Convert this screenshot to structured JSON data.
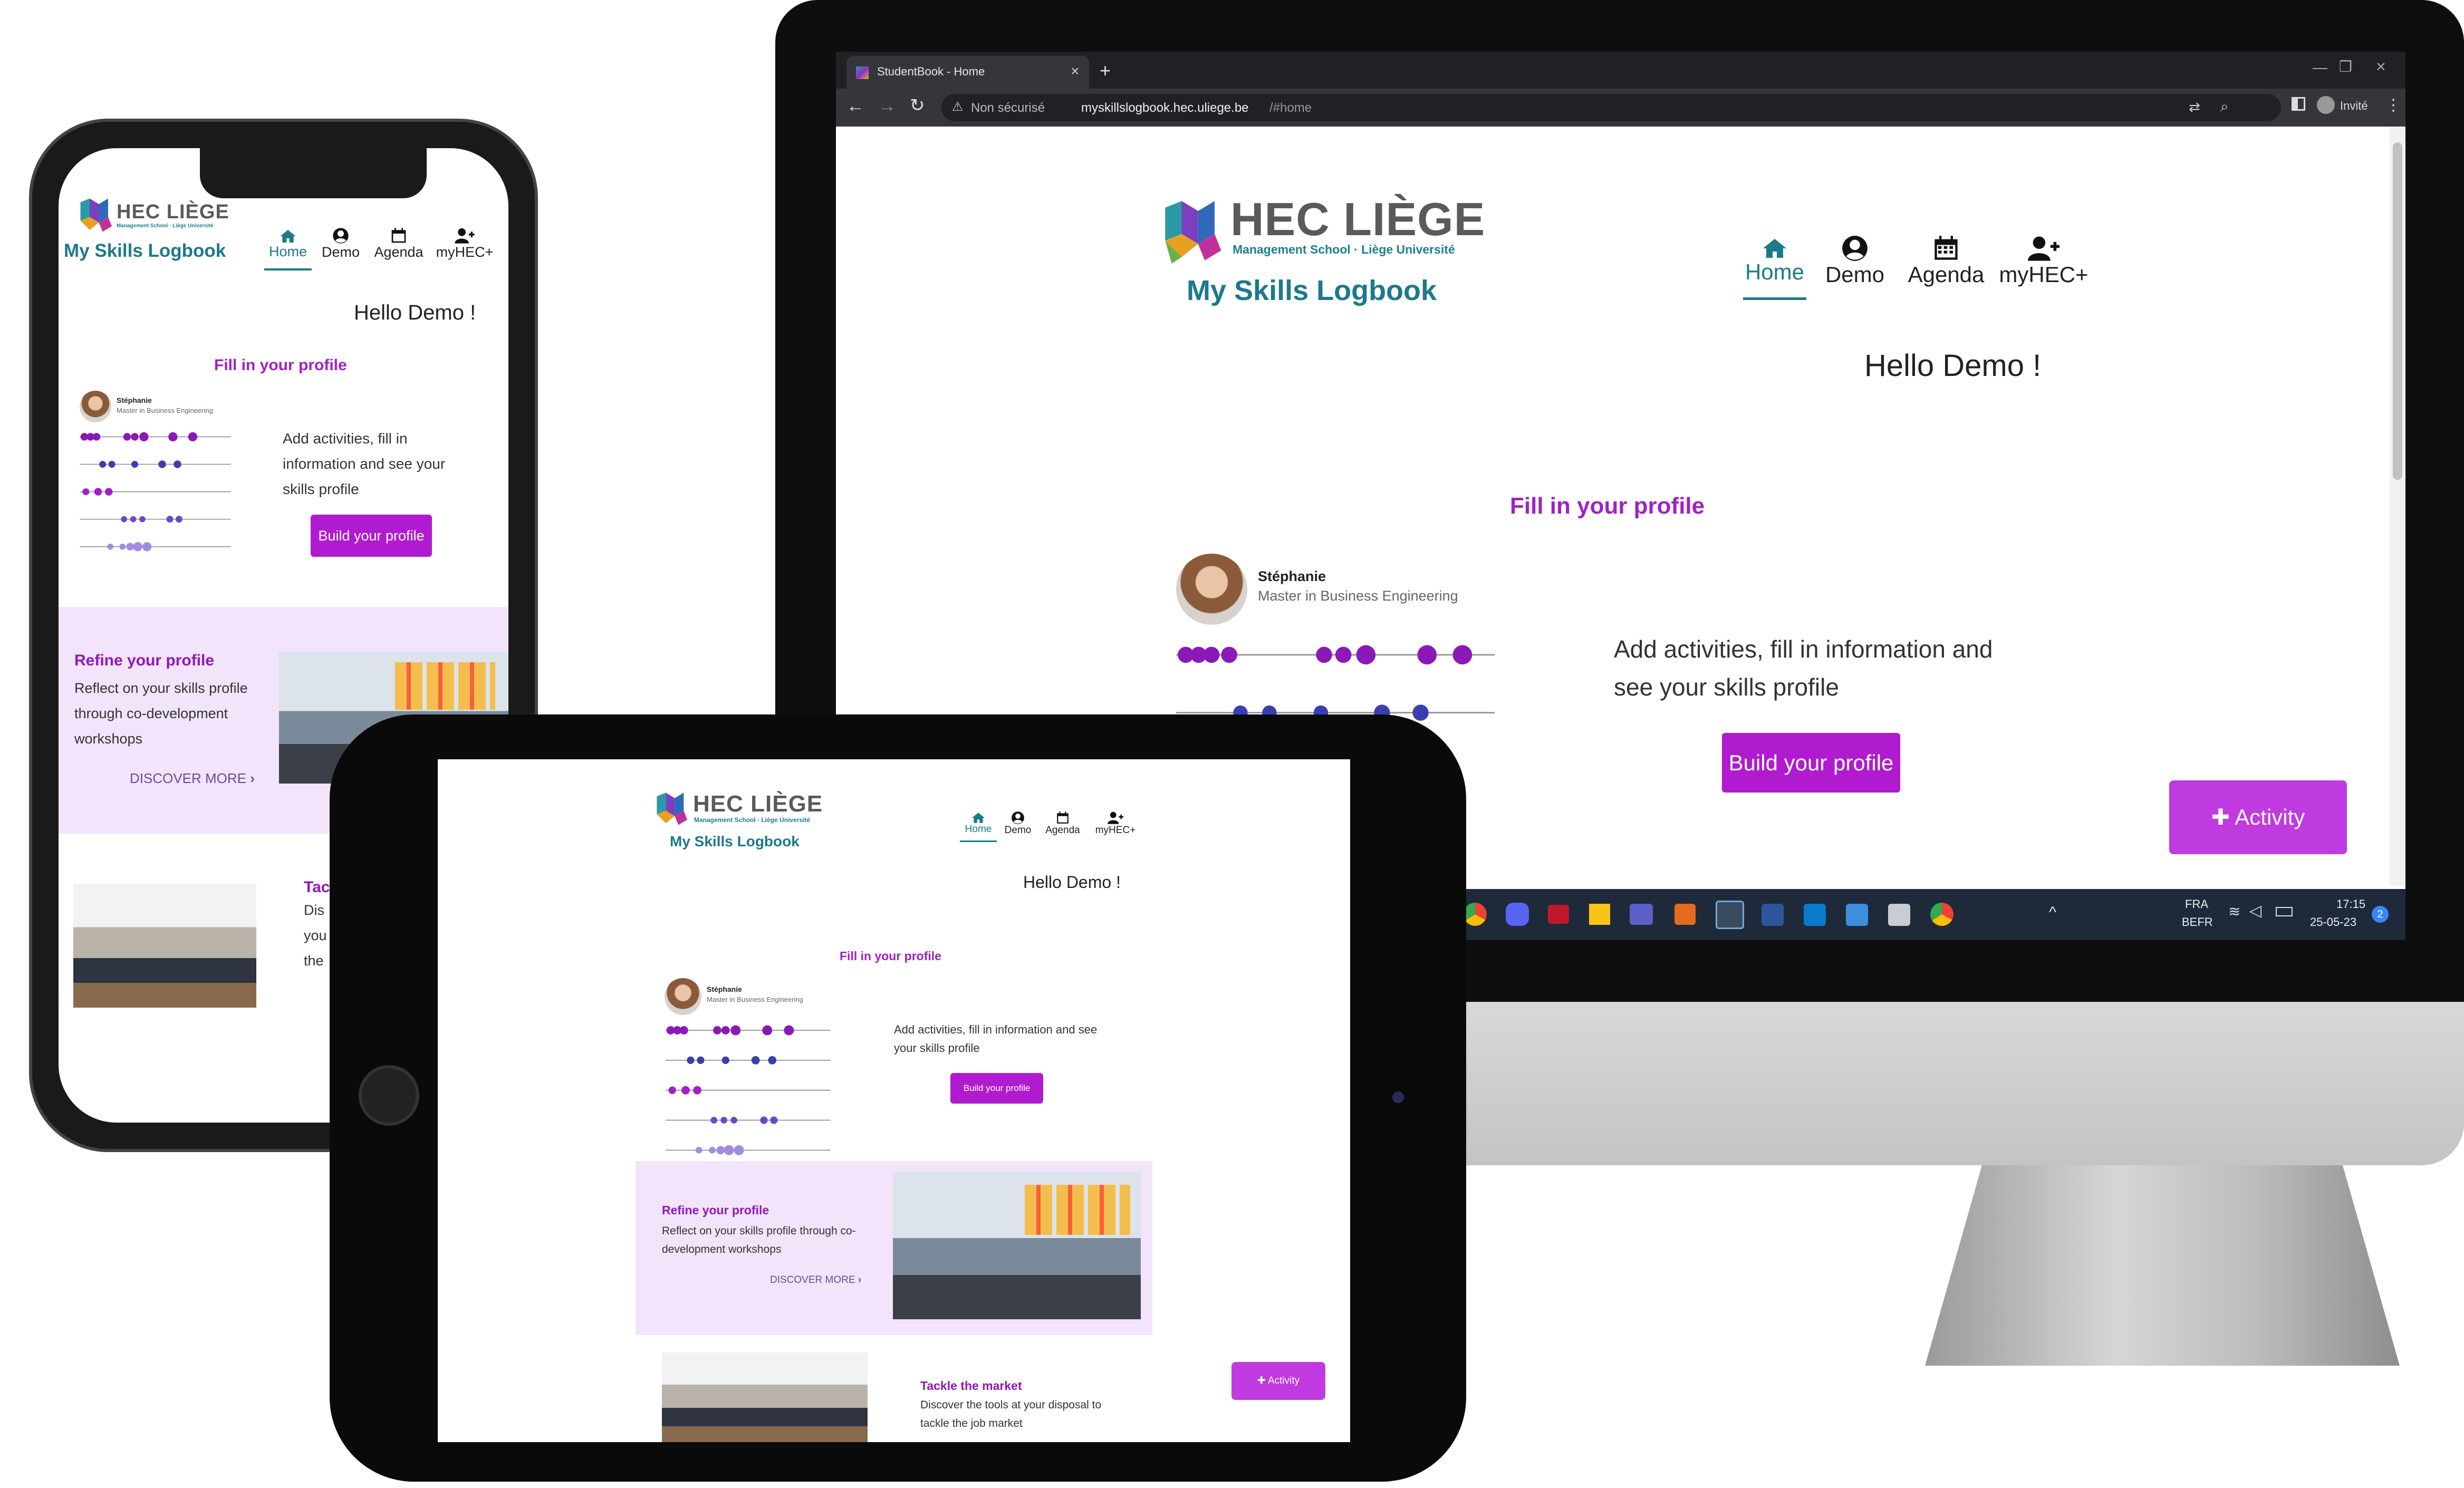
{
  "browser": {
    "tab_title": "StudentBook - Home",
    "not_secure": "Non sécurisé",
    "url_host": "myskillslogbook.hec.uliege.be",
    "url_path": "/#home",
    "profile_label": "Invité"
  },
  "app": {
    "logo_word": "HEC LIÈGE",
    "logo_sub": "Management School · Liège Université",
    "title": "My Skills Logbook",
    "nav": [
      {
        "label": "Home",
        "icon": "home-icon"
      },
      {
        "label": "Demo",
        "icon": "user-circle-icon"
      },
      {
        "label": "Agenda",
        "icon": "calendar-icon"
      },
      {
        "label": "myHEC+",
        "icon": "user-plus-icon"
      }
    ],
    "greeting": "Hello Demo !",
    "fill_profile": {
      "title": "Fill in your profile",
      "text": "Add activities, fill in information and see your skills profile",
      "button": "Build your profile",
      "person_name": "Stéphanie",
      "person_program": "Master in Business Engineering"
    },
    "refine": {
      "title": "Refine your profile",
      "text": "Reflect on your skills profile through co-development workshops",
      "link": "DISCOVER MORE"
    },
    "tackle": {
      "title": "Tackle the market",
      "text": "Discover the tools at your disposal to tackle the job market",
      "phone_title_partial": "Tac",
      "phone_text_partial_1": "Dis",
      "phone_text_partial_2": "you",
      "phone_text_partial_3": "the"
    },
    "activity_button": "Activity"
  },
  "taskbar": {
    "lang_1": "FRA",
    "lang_2": "BEFR",
    "time": "17:15",
    "date": "25-05-23",
    "badge": "2"
  },
  "colors": {
    "brand_teal": "#1c7a8a",
    "accent_purple": "#b01bcf",
    "pane_lilac": "#f2e4fa"
  }
}
